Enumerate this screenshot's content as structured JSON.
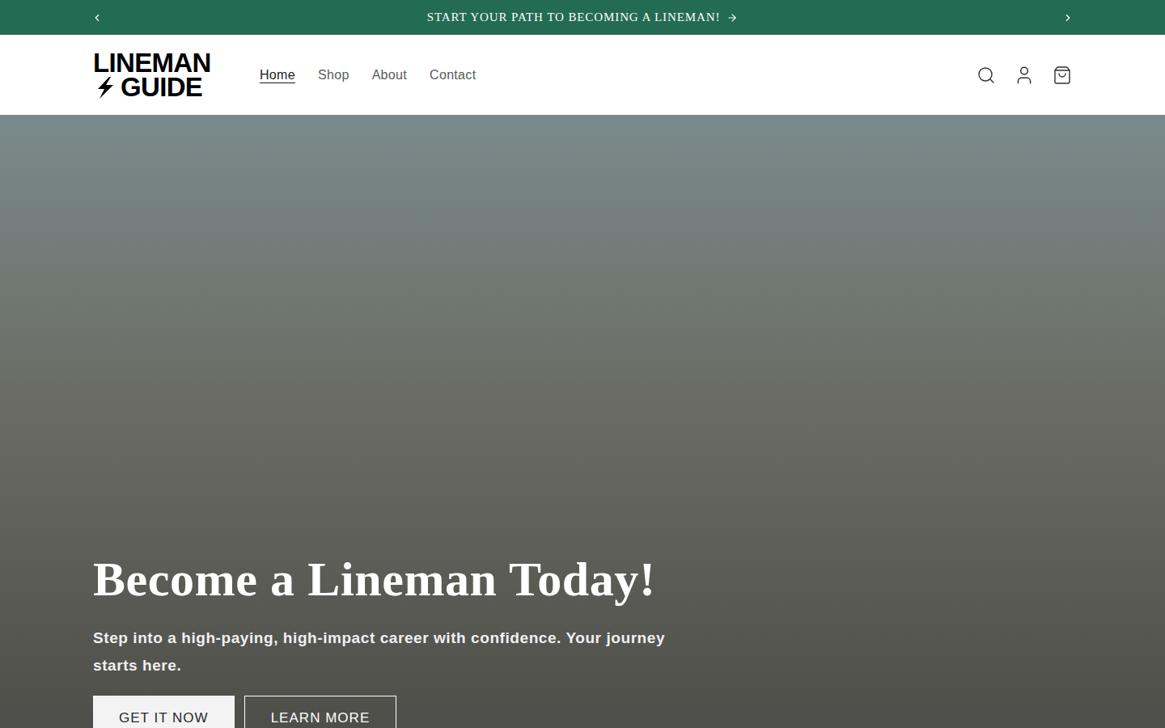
{
  "announcement": {
    "text": "START YOUR PATH TO BECOMING A LINEMAN!"
  },
  "logo": {
    "line1": "LINEMAN",
    "line2": "GUIDE"
  },
  "nav": [
    {
      "label": "Home",
      "selected": true
    },
    {
      "label": "Shop",
      "selected": false
    },
    {
      "label": "About",
      "selected": false
    },
    {
      "label": "Contact",
      "selected": false
    }
  ],
  "hero": {
    "title": "Become a Lineman Today!",
    "subtitle": "Step into a high-paying, high-impact career with confidence. Your journey starts here.",
    "buttons": [
      {
        "label": "GET IT NOW",
        "kind": "solid"
      },
      {
        "label": "LEARN MORE",
        "kind": "outline"
      }
    ]
  }
}
